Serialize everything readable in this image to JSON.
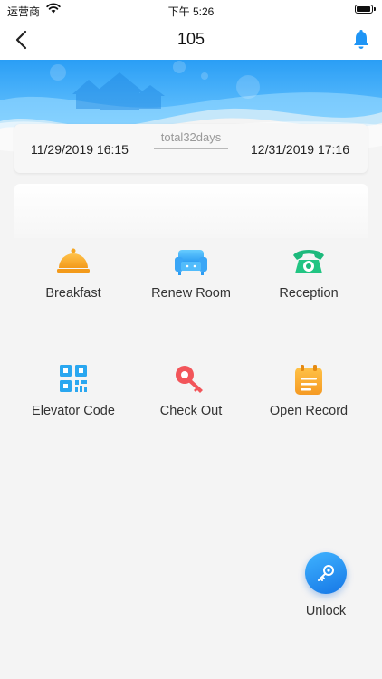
{
  "status_bar": {
    "carrier": "运营商",
    "time": "下午 5:26"
  },
  "nav": {
    "title": "105"
  },
  "stay": {
    "start": "11/29/2019 16:15",
    "total": "total32days",
    "end": "12/31/2019 17:16"
  },
  "menu": [
    {
      "label": "Breakfast",
      "icon": "cloche-icon"
    },
    {
      "label": "Renew Room",
      "icon": "sofa-icon"
    },
    {
      "label": "Reception",
      "icon": "telephone-icon"
    },
    {
      "label": "Elevator Code",
      "icon": "qr-code-icon"
    },
    {
      "label": "Check Out",
      "icon": "key-icon"
    },
    {
      "label": "Open Record",
      "icon": "calendar-icon"
    }
  ],
  "unlock": {
    "label": "Unlock",
    "icon": "key-circle-icon"
  },
  "colors": {
    "accent_blue": "#1f95f5",
    "orange": "#f5a623",
    "teal": "#1db97c",
    "red": "#f2555a",
    "sky": "#35a6f5"
  }
}
